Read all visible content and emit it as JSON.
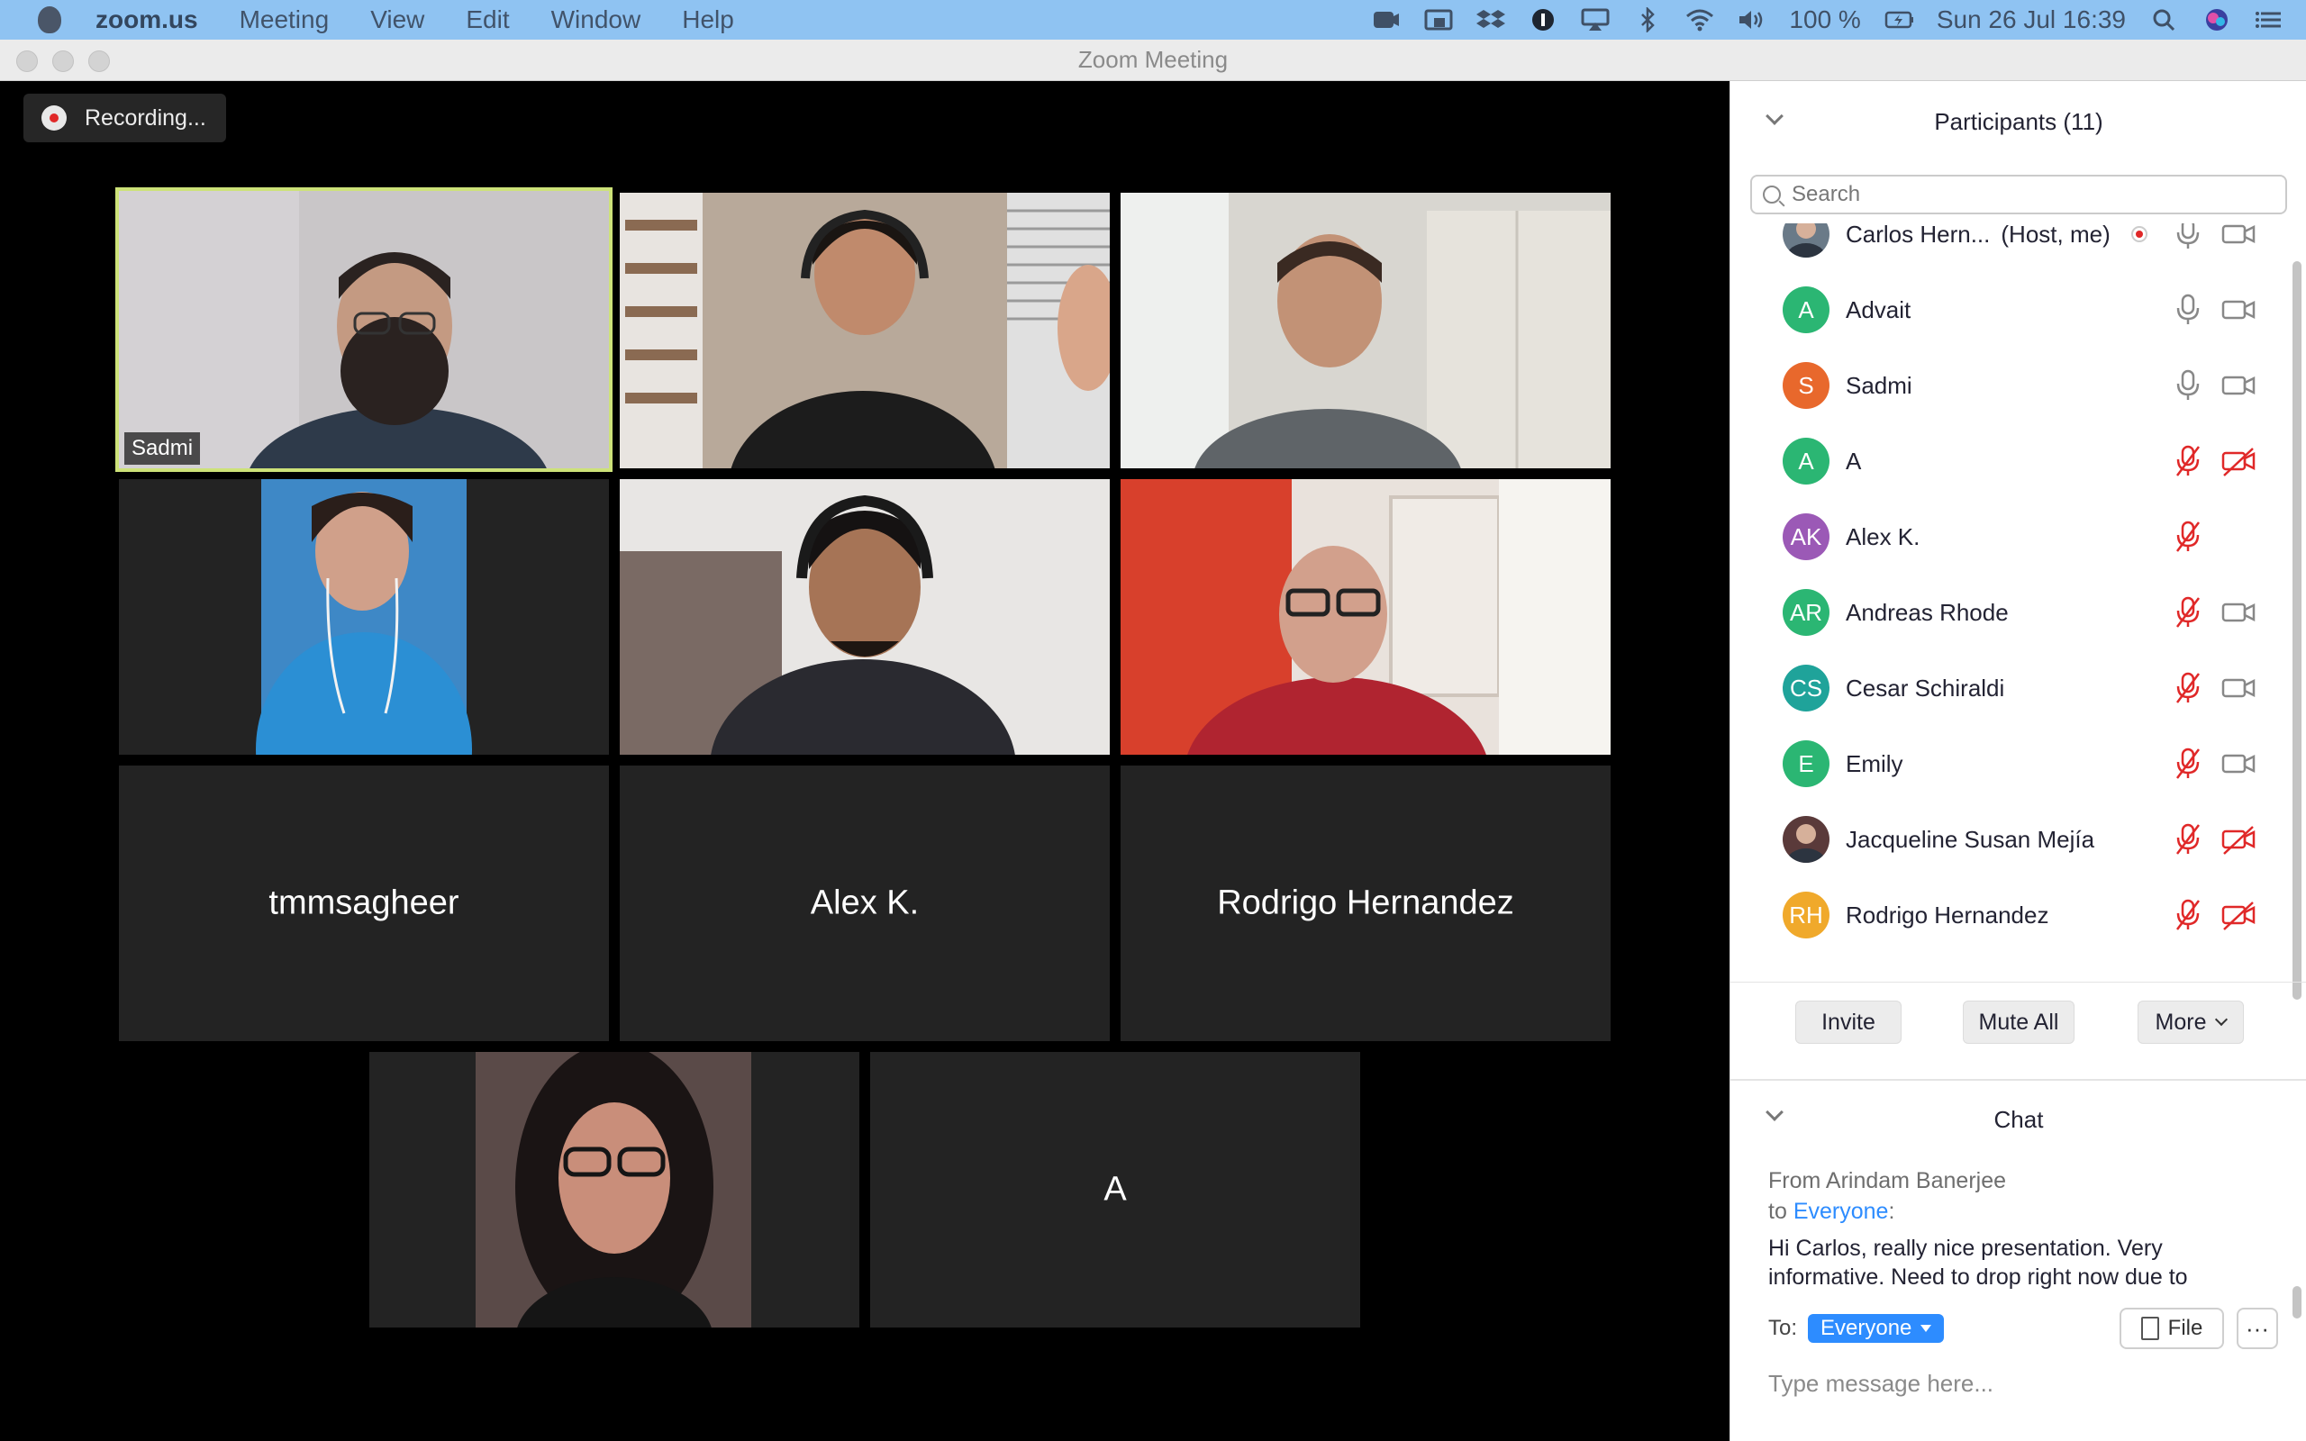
{
  "menubar": {
    "app": "zoom.us",
    "items": [
      "Meeting",
      "View",
      "Edit",
      "Window",
      "Help"
    ],
    "battery": "100 %",
    "clock": "Sun 26 Jul  16:39"
  },
  "window": {
    "title": "Zoom Meeting"
  },
  "recording": {
    "label": "Recording..."
  },
  "tiles": {
    "sadmi": "Sadmi",
    "tmmsagheer": "tmmsagheer",
    "alexk": "Alex K.",
    "rodrigo": "Rodrigo Hernandez",
    "a": "A"
  },
  "participants": {
    "header": "Participants (11)",
    "search_placeholder": "Search",
    "list": [
      {
        "name": "Carlos Hern...",
        "role": "(Host, me)",
        "initials": "",
        "color": "#6a7a88",
        "mic": "on",
        "cam": "on",
        "recording": true
      },
      {
        "name": "Advait",
        "initials": "A",
        "color": "#2bb673",
        "mic": "on",
        "cam": "on"
      },
      {
        "name": "Sadmi",
        "initials": "S",
        "color": "#e8682c",
        "mic": "on",
        "cam": "on"
      },
      {
        "name": "A",
        "initials": "A",
        "color": "#2bb673",
        "mic": "muted",
        "cam": "off"
      },
      {
        "name": "Alex K.",
        "initials": "AK",
        "color": "#9b59b6",
        "mic": "muted",
        "cam": "none"
      },
      {
        "name": "Andreas Rhode",
        "initials": "AR",
        "color": "#2bb673",
        "mic": "muted",
        "cam": "on"
      },
      {
        "name": "Cesar Schiraldi",
        "initials": "CS",
        "color": "#1fa39a",
        "mic": "muted",
        "cam": "on"
      },
      {
        "name": "Emily",
        "initials": "E",
        "color": "#2bb673",
        "mic": "muted",
        "cam": "on"
      },
      {
        "name": "Jacqueline Susan Mejía",
        "initials": "",
        "color": "#5a3a3a",
        "mic": "muted",
        "cam": "off"
      },
      {
        "name": "Rodrigo Hernandez",
        "initials": "RH",
        "color": "#f0a92b",
        "mic": "muted",
        "cam": "off"
      }
    ],
    "invite": "Invite",
    "mute_all": "Mute All",
    "more": "More"
  },
  "chat": {
    "header": "Chat",
    "from_line": "From Arindam Banerjee",
    "to_prefix": "to",
    "to_target": "Everyone",
    "to_suffix": ":",
    "message": "Hi Carlos, really nice presentation. Very informative. Need to drop right now due to",
    "to_label": "To:",
    "recipient": "Everyone",
    "file_label": "File",
    "more_label": "···",
    "input_placeholder": "Type message here..."
  },
  "colors": {
    "accent": "#2d8cff",
    "active_speaker": "#cde279",
    "muted": "#e02828"
  }
}
